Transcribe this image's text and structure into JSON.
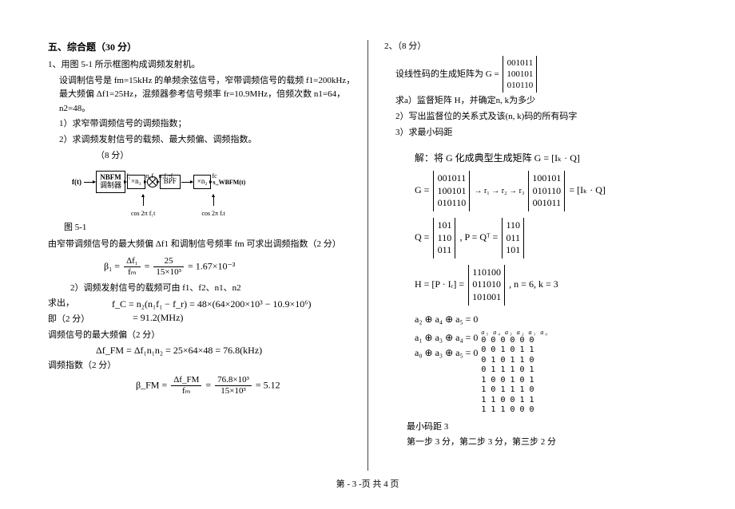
{
  "left": {
    "section_title": "五、综合题（30 分）",
    "q1_title": "1、用图 5-1 所示框图构成调频发射机。",
    "q1_desc": "设调制信号是 fm=15kHz 的单频余弦信号，窄带调频信号的载频 f1=200kHz，最大频偏 Δf1=25Hz，混频器参考信号频率 fr=10.9MHz，倍频次数 n1=64，n2=48。",
    "q1_bullet1": "1）求窄带调频信号的调频指数；",
    "q1_bullet2": "2）求调频发射信号的载频、最大频偏、调频指数。",
    "q1_points": "（8 分）",
    "diagram": {
      "in": "f(t)",
      "box1_l1": "NBFM",
      "box1_l2": "调制器",
      "lab_f1": "f₁",
      "lab_b1": "β₁",
      "box2": "×n₁",
      "lab_n1f1": "n₁f₁",
      "lab_n1df1": "n₁Δf₁",
      "lab_n1b1": "n₁β₁",
      "mix_top": "n₁f₁-fᵣ",
      "mix_bot": "n₁Δf₁",
      "mix_bot2": "n₁β₁",
      "box3": "BPF",
      "box4": "×n₂",
      "lab_fc": "fc",
      "lab_dfm": "Δf_FM",
      "lab_bfm": "β_FM",
      "out": "s_WBFM(t)",
      "osc1": "cos 2π f₁t",
      "osc2": "cos 2π fᵣt"
    },
    "fig_label": "图 5-1",
    "sol1_intro": "由窄带调频信号的最大频偏 Δf1 和调制信号频率 fm 可求出调频指数（2 分）",
    "eq1": {
      "lhs": "β₁ =",
      "top1": "Δf₁",
      "bot1": "fₘ",
      "eq": "=",
      "top2": "25",
      "bot2": "15×10³",
      "rhs": "= 1.67×10⁻³"
    },
    "sol2_intro": "2）调频发射信号的载频可由 f1、f2、n1、n2",
    "sol2_label1": "求出，",
    "sol2_label2": "即（2 分）",
    "eq2_line1": "f_C = n₂(n₁f₁ − f_r) = 48×(64×200×10³ − 10.9×10⁶)",
    "eq2_line2": "= 91.2(MHz)",
    "sol3_intro": "调频信号的最大频偏（2 分）",
    "eq3": "Δf_FM = Δf₁n₁n₂ = 25×64×48 = 76.8(kHz)",
    "sol4_intro": "调频指数（2 分）",
    "eq4": {
      "lhs": "β_FM =",
      "top1": "Δf_FM",
      "bot1": "fₘ",
      "eq": "=",
      "top2": "76.8×10³",
      "bot2": "15×10³",
      "rhs": "= 5.12"
    }
  },
  "right": {
    "q2_title": "2、（8 分）",
    "q2_desc_pre": "设线性码的生成矩阵为 G =",
    "q2_matrix_rows": [
      "001011",
      "100101",
      "010110"
    ],
    "q2_b1": "求a）监督矩阵 H，并确定n, k为多少",
    "q2_b2": "2）写出监督位的关系式及该(n, k)码的所有码字",
    "q2_b3": "3）求最小码距",
    "sol_intro": "解：将 G 化成典型生成矩阵 G = [Iₖ · Q]",
    "gtrans_rows": [
      "001011",
      "100101",
      "010110"
    ],
    "gtrans_res_rows": [
      "100101",
      "010110",
      "001011"
    ],
    "gtrans_ops": "→ r₁ → r₂ → r₃",
    "gtrans_eq": "= [Iₖ · Q]",
    "q_rows": [
      "101",
      "110",
      "011"
    ],
    "p_rows": [
      "110",
      "011",
      "101"
    ],
    "q_eq_lhs": "Q =",
    "p_eq_mid": ", P = Qᵀ =",
    "h_lhs": "H = [P · Iᵣ] =",
    "h_rows": [
      "110100",
      "011010",
      "101001"
    ],
    "h_suffix": ", n = 6, k = 3",
    "rel1": "a₂ ⊕ a₄ ⊕ a₅ = 0",
    "rel2": "a₁ ⊕ a₃ ⊕ a₄ = 0",
    "rel3": "a₀ ⊕ a₃ ⊕ a₅ = 0",
    "table_header": "a₅  a₄  a₃  a₂  a₁  a₀",
    "table_rows": [
      "000000",
      "001011",
      "010110",
      "011101",
      "100101",
      "101110",
      "110011",
      "111000"
    ],
    "min_dist": "最小码距 3",
    "grading": "第一步 3 分，第二步 3 分，第三步 2 分"
  },
  "footer": "第  - 3 -页    共  4 页"
}
